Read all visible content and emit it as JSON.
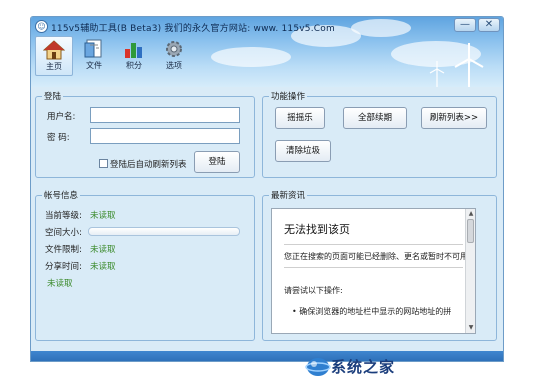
{
  "window": {
    "title": "115v5辅助工具(B Beta3) 我们的永久官方网站: www. 115v5.Com",
    "minimize_label": "—",
    "close_label": "✕"
  },
  "toolbar": {
    "items": [
      {
        "label": "主页",
        "icon": "home-icon"
      },
      {
        "label": "文件",
        "icon": "file-icon"
      },
      {
        "label": "积分",
        "icon": "chart-icon"
      },
      {
        "label": "选项",
        "icon": "gear-icon"
      }
    ]
  },
  "login": {
    "group_title": "登陆",
    "username_label": "用户名:",
    "username_value": "",
    "password_label": "密  码:",
    "password_value": "",
    "auto_refresh_label": "登陆后自动刷新列表",
    "login_button": "登陆"
  },
  "functions": {
    "group_title": "功能操作",
    "shake_button": "摇摇乐",
    "renew_all_button": "全部续期",
    "refresh_list_button": "刷新列表>>",
    "clear_trash_button": "清除垃圾"
  },
  "account": {
    "group_title": "帐号信息",
    "level_label": "当前等级:",
    "level_value": "未读取",
    "space_label": "空间大小:",
    "space_fill": 0,
    "file_limit_label": "文件限制:",
    "file_limit_value": "未读取",
    "share_time_label": "分享时间:",
    "share_time_value": "未读取",
    "extra_value": "未读取"
  },
  "news": {
    "group_title": "最新资讯",
    "page_title": "无法找到该页",
    "line1": "您正在搜索的页面可能已经删除、更名或暂时不可用",
    "line2": "请尝试以下操作:",
    "bullet": "确保浏览器的地址栏中显示的网站地址的拼"
  },
  "watermark": {
    "text": "系统之家"
  },
  "colors": {
    "accent": "#2b6cb5",
    "panel_bg": "#d9ebf7",
    "status_green": "#3a8a2a"
  }
}
